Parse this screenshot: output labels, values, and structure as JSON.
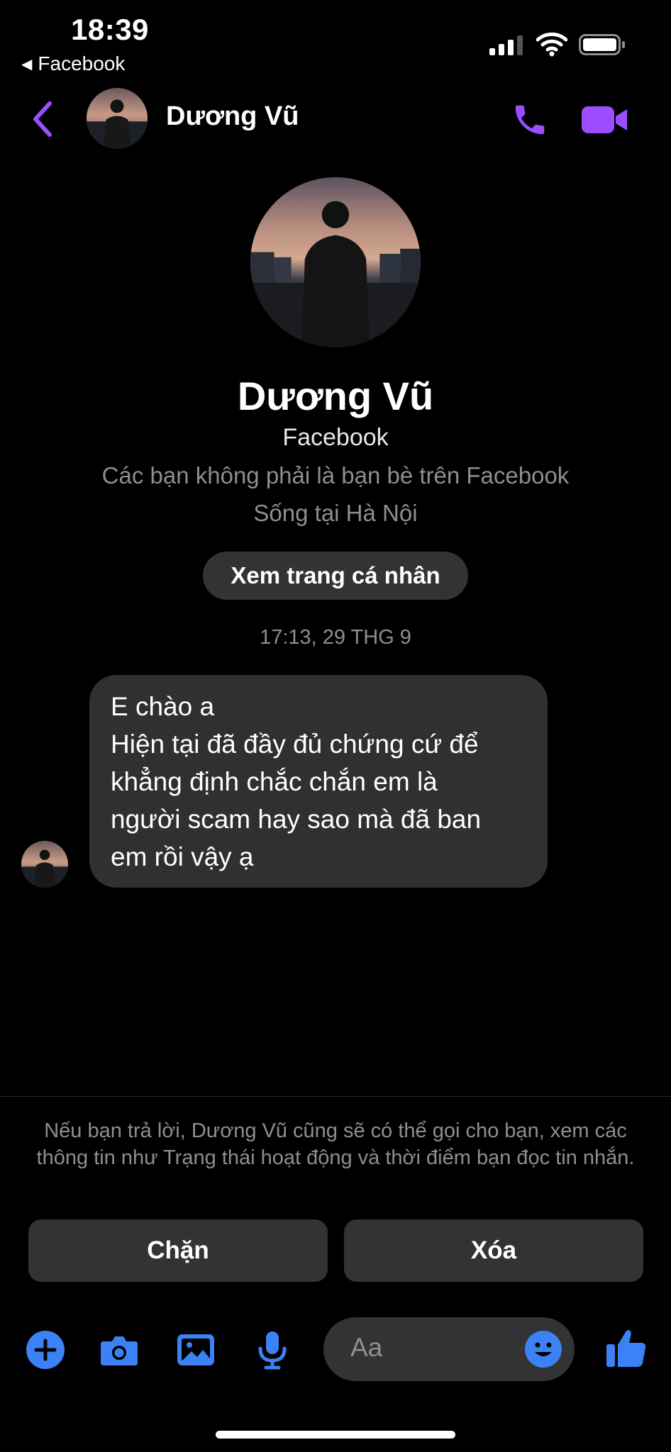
{
  "status": {
    "time": "18:39",
    "back_app": "Facebook"
  },
  "header": {
    "name": "Dương Vũ"
  },
  "profile": {
    "name": "Dương Vũ",
    "subtitle": "Facebook",
    "lines": [
      "Các bạn không phải là bạn bè trên Facebook",
      "Sống tại Hà Nội"
    ],
    "button_label": "Xem trang cá nhân"
  },
  "chat": {
    "timestamp": "17:13, 29 THG 9",
    "message_lines": [
      "E chào a",
      "Hiện tại đã đầy đủ chứng cứ để",
      "khẳng định chắc chắn em là",
      "người scam hay sao mà đã ban",
      "em rồi vậy ạ"
    ]
  },
  "request": {
    "notice": "Nếu bạn trả lời, Dương Vũ cũng sẽ có thể gọi cho bạn, xem các thông tin như Trạng thái hoạt động và thời điểm bạn đọc tin nhắn.",
    "block_label": "Chặn",
    "delete_label": "Xóa"
  },
  "composer": {
    "placeholder": "Aa",
    "icons": [
      "plus-icon",
      "camera-icon",
      "gallery-icon",
      "microphone-icon",
      "emoji-icon",
      "like-icon"
    ]
  },
  "colors": {
    "accent_purple": "#9b4dff",
    "accent_blue": "#3b82f6",
    "bubble": "#303033",
    "button": "#333335"
  }
}
